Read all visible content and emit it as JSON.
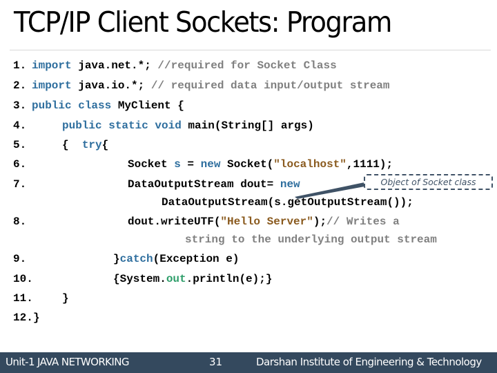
{
  "slide": {
    "title": "TCP/IP Client Sockets: Program",
    "lines": [
      {
        "num": "1.",
        "parts": [
          {
            "t": "import",
            "c": "kw"
          },
          {
            "t": " java.net.*;",
            "c": ""
          },
          {
            "t": " //required for Socket Class",
            "c": "cm"
          }
        ]
      },
      {
        "num": "2.",
        "parts": [
          {
            "t": "import",
            "c": "kw"
          },
          {
            "t": " java.io.*;",
            "c": ""
          },
          {
            "t": " // required data input/output stream",
            "c": "cm"
          }
        ]
      },
      {
        "num": "3.",
        "parts": [
          {
            "t": "public class",
            "c": "kw"
          },
          {
            "t": " MyClient {",
            "c": ""
          }
        ]
      },
      {
        "num": "4.",
        "parts": [
          {
            "t": "public static void",
            "c": "kw"
          },
          {
            "t": " main(String[] args)",
            "c": ""
          }
        ]
      },
      {
        "num": "5.",
        "parts": [
          {
            "t": "{  ",
            "c": ""
          },
          {
            "t": "try",
            "c": "kw"
          },
          {
            "t": "{",
            "c": ""
          }
        ]
      },
      {
        "num": "6.",
        "parts": [
          {
            "t": "Socket ",
            "c": ""
          },
          {
            "t": "s",
            "c": "kw"
          },
          {
            "t": " = ",
            "c": ""
          },
          {
            "t": "new",
            "c": "kw"
          },
          {
            "t": " Socket(",
            "c": ""
          },
          {
            "t": "\"localhost\"",
            "c": "str"
          },
          {
            "t": ",1111);",
            "c": ""
          }
        ]
      },
      {
        "num": "7.",
        "parts": [
          {
            "t": "DataOutputStream dout= ",
            "c": ""
          },
          {
            "t": "new",
            "c": "kw"
          }
        ]
      },
      {
        "num": "",
        "parts": [
          {
            "t": "DataOutputStream(s.getOutputStream());",
            "c": ""
          }
        ]
      },
      {
        "num": "8.",
        "parts": [
          {
            "t": "dout.writeUTF(",
            "c": ""
          },
          {
            "t": "\"Hello Server\"",
            "c": "str"
          },
          {
            "t": ");",
            "c": ""
          },
          {
            "t": "// Writes a",
            "c": "cm"
          }
        ]
      },
      {
        "num": "",
        "parts": [
          {
            "t": "string to the underlying output stream",
            "c": "cm"
          }
        ]
      },
      {
        "num": "9.",
        "parts": [
          {
            "t": "}",
            "c": ""
          },
          {
            "t": "catch",
            "c": "kw"
          },
          {
            "t": "(Exception e)",
            "c": ""
          }
        ]
      },
      {
        "num": "10.",
        "parts": [
          {
            "t": "{System.",
            "c": ""
          },
          {
            "t": "out",
            "c": "fld"
          },
          {
            "t": ".println(e);}",
            "c": ""
          }
        ]
      },
      {
        "num": "11.",
        "parts": [
          {
            "t": "}",
            "c": ""
          }
        ]
      },
      {
        "num": "12.",
        "parts": [
          {
            "t": "}",
            "c": ""
          }
        ]
      }
    ],
    "callout": {
      "text": "Object of Socket class",
      "points_to": "s"
    }
  },
  "footer": {
    "unit": "Unit-1 JAVA NETWORKING",
    "page_number": "31",
    "institute": "Darshan Institute of Engineering & Technology"
  },
  "colors": {
    "keyword": "#2e6e9e",
    "comment": "#808080",
    "string": "#8a5a1e",
    "field": "#2e9e6a",
    "footer_bg": "#34495e",
    "callout_border": "#3f5266"
  }
}
